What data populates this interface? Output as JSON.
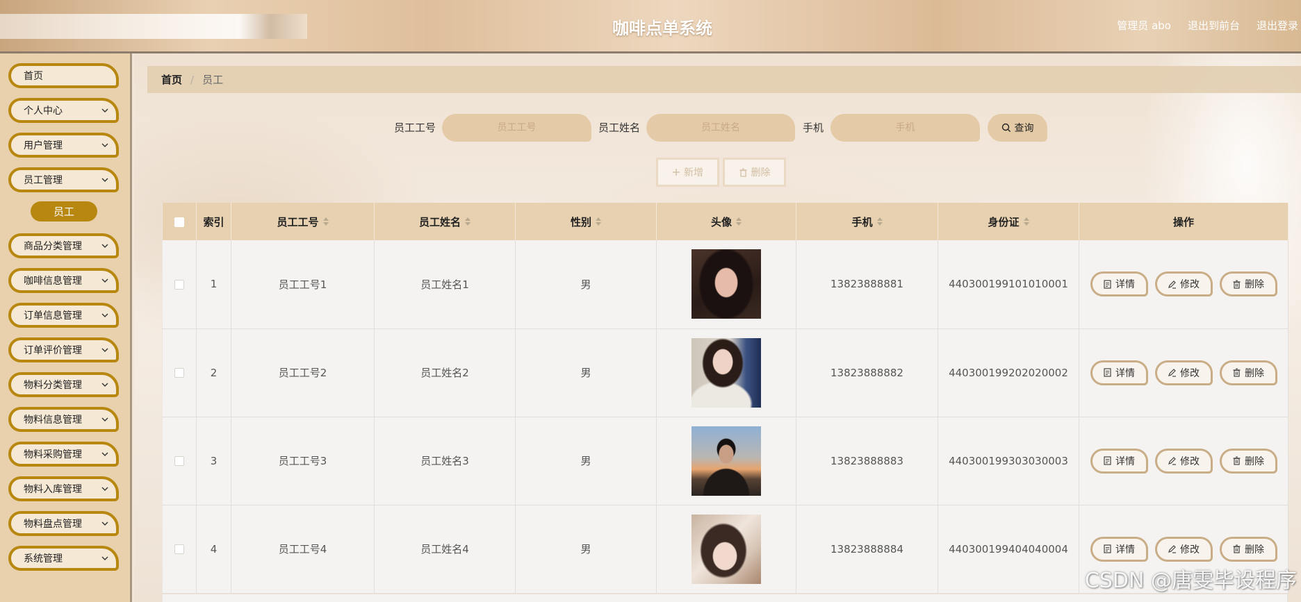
{
  "header": {
    "title": "咖啡点单系统",
    "user_label": "管理员 abo",
    "front_link": "退出到前台",
    "logout_link": "退出登录"
  },
  "sidebar": {
    "items": [
      {
        "label": "首页",
        "expandable": false
      },
      {
        "label": "个人中心",
        "expandable": true
      },
      {
        "label": "用户管理",
        "expandable": true
      },
      {
        "label": "员工管理",
        "expandable": true,
        "children": [
          {
            "label": "员工",
            "active": true
          }
        ]
      },
      {
        "label": "商品分类管理",
        "expandable": true
      },
      {
        "label": "咖啡信息管理",
        "expandable": true
      },
      {
        "label": "订单信息管理",
        "expandable": true
      },
      {
        "label": "订单评价管理",
        "expandable": true
      },
      {
        "label": "物料分类管理",
        "expandable": true
      },
      {
        "label": "物料信息管理",
        "expandable": true
      },
      {
        "label": "物料采购管理",
        "expandable": true
      },
      {
        "label": "物料入库管理",
        "expandable": true
      },
      {
        "label": "物料盘点管理",
        "expandable": true
      },
      {
        "label": "系统管理",
        "expandable": true
      }
    ]
  },
  "breadcrumb": {
    "home": "首页",
    "separator": "/",
    "current": "员工"
  },
  "search": {
    "fields": [
      {
        "label": "员工工号",
        "placeholder": "员工工号",
        "value": ""
      },
      {
        "label": "员工姓名",
        "placeholder": "员工姓名",
        "value": ""
      },
      {
        "label": "手机",
        "placeholder": "手机",
        "value": ""
      }
    ],
    "query_label": "查询"
  },
  "toolbar": {
    "add_label": "新增",
    "delete_label": "删除"
  },
  "table": {
    "columns": [
      {
        "label": "索引",
        "sortable": false
      },
      {
        "label": "员工工号",
        "sortable": true
      },
      {
        "label": "员工姓名",
        "sortable": true
      },
      {
        "label": "性别",
        "sortable": true
      },
      {
        "label": "头像",
        "sortable": true
      },
      {
        "label": "手机",
        "sortable": true
      },
      {
        "label": "身份证",
        "sortable": true
      },
      {
        "label": "操作",
        "sortable": false
      }
    ],
    "rows": [
      {
        "index": "1",
        "employee_no": "员工工号1",
        "employee_name": "员工姓名1",
        "gender": "男",
        "phone": "13823888881",
        "id_card": "440300199101010001"
      },
      {
        "index": "2",
        "employee_no": "员工工号2",
        "employee_name": "员工姓名2",
        "gender": "男",
        "phone": "13823888882",
        "id_card": "440300199202020002"
      },
      {
        "index": "3",
        "employee_no": "员工工号3",
        "employee_name": "员工姓名3",
        "gender": "男",
        "phone": "13823888883",
        "id_card": "440300199303030003"
      },
      {
        "index": "4",
        "employee_no": "员工工号4",
        "employee_name": "员工姓名4",
        "gender": "男",
        "phone": "13823888884",
        "id_card": "440300199404040004"
      }
    ],
    "row_actions": {
      "detail": "详情",
      "edit": "修改",
      "delete": "删除"
    }
  },
  "watermark": "CSDN @唐雯毕设程序",
  "icons": {
    "expand": "chevron-down-icon",
    "query": "search-icon",
    "add": "plus-icon",
    "batch_delete": "trash-icon",
    "sort": "sort-icon",
    "detail": "document-icon",
    "edit": "pencil-icon",
    "delete": "trash-icon"
  },
  "colors": {
    "sidebar_accent": "#b8870f",
    "sidebar_bg": "#e9d1ae",
    "input_bg": "#e4caa6",
    "table_header_bg": "#e7d1b1",
    "action_border": "#c9ad86",
    "title_text": "#ffffff"
  }
}
